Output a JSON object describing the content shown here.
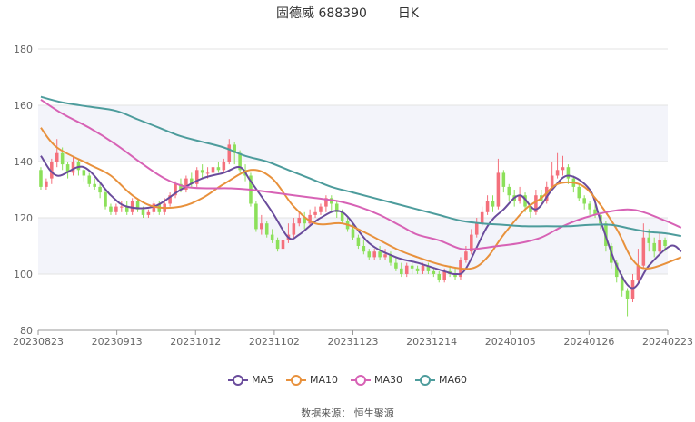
{
  "header": {
    "name_code": "固德威 688390",
    "period": "日K"
  },
  "source": "数据来源： 恒生聚源",
  "chart_data": {
    "type": "candlestick",
    "ylim": [
      80,
      180
    ],
    "yticks": [
      80,
      100,
      120,
      140,
      160,
      180
    ],
    "xticks": [
      "20230823",
      "20230913",
      "20231012",
      "20231102",
      "20231123",
      "20231214",
      "20240105",
      "20240126",
      "20240223"
    ],
    "colors": {
      "up": "#f4707c",
      "down": "#8ce05a",
      "MA5": "#6a4c9c",
      "MA10": "#e8913c",
      "MA30": "#d762b5",
      "MA60": "#4d9c9c"
    },
    "candles": [
      [
        137,
        131,
        138,
        130
      ],
      [
        131,
        133,
        134,
        130
      ],
      [
        134,
        140,
        141,
        132
      ],
      [
        140,
        143,
        148,
        138
      ],
      [
        143,
        139,
        145,
        137
      ],
      [
        139,
        136,
        140,
        134
      ],
      [
        136,
        140,
        142,
        135
      ],
      [
        140,
        137,
        141,
        135
      ],
      [
        137,
        135,
        138,
        133
      ],
      [
        135,
        132,
        136,
        131
      ],
      [
        132,
        131,
        134,
        130
      ],
      [
        131,
        129,
        133,
        127
      ],
      [
        129,
        124,
        130,
        123
      ],
      [
        124,
        122,
        125,
        121
      ],
      [
        122,
        124,
        125,
        121
      ],
      [
        124,
        124,
        126,
        122
      ],
      [
        124,
        122,
        126,
        121
      ],
      [
        122,
        126,
        127,
        121
      ],
      [
        126,
        123,
        127,
        122
      ],
      [
        123,
        121,
        124,
        120
      ],
      [
        121,
        122,
        123,
        120
      ],
      [
        122,
        125,
        126,
        121
      ],
      [
        125,
        122,
        126,
        121
      ],
      [
        122,
        125,
        127,
        121
      ],
      [
        125,
        128,
        129,
        124
      ],
      [
        128,
        132,
        133,
        127
      ],
      [
        132,
        130,
        134,
        129
      ],
      [
        130,
        134,
        135,
        129
      ],
      [
        134,
        132,
        136,
        131
      ],
      [
        132,
        137,
        138,
        131
      ],
      [
        137,
        136,
        139,
        134
      ],
      [
        136,
        136,
        138,
        134
      ],
      [
        136,
        138,
        140,
        135
      ],
      [
        138,
        137,
        140,
        136
      ],
      [
        137,
        140,
        141,
        136
      ],
      [
        140,
        146,
        148,
        139
      ],
      [
        146,
        143,
        147,
        139
      ],
      [
        143,
        137,
        144,
        136
      ],
      [
        137,
        135,
        139,
        133
      ],
      [
        135,
        125,
        136,
        124
      ],
      [
        125,
        116,
        126,
        115
      ],
      [
        116,
        118,
        121,
        114
      ],
      [
        118,
        114,
        119,
        113
      ],
      [
        114,
        112,
        116,
        111
      ],
      [
        112,
        109,
        113,
        108
      ],
      [
        109,
        112,
        115,
        108
      ],
      [
        112,
        114,
        118,
        111
      ],
      [
        114,
        118,
        120,
        113
      ],
      [
        118,
        120,
        122,
        117
      ],
      [
        120,
        118,
        122,
        116
      ],
      [
        118,
        121,
        123,
        117
      ],
      [
        121,
        122,
        124,
        120
      ],
      [
        122,
        124,
        125,
        121
      ],
      [
        124,
        127,
        128,
        122
      ],
      [
        127,
        125,
        128,
        122
      ],
      [
        125,
        122,
        126,
        120
      ],
      [
        122,
        119,
        123,
        118
      ],
      [
        119,
        116,
        120,
        115
      ],
      [
        116,
        113,
        118,
        112
      ],
      [
        113,
        110,
        114,
        109
      ],
      [
        110,
        108,
        112,
        107
      ],
      [
        108,
        106,
        109,
        105
      ],
      [
        106,
        108,
        109,
        105
      ],
      [
        108,
        106,
        110,
        105
      ],
      [
        106,
        107,
        109,
        105
      ],
      [
        107,
        104,
        108,
        103
      ],
      [
        104,
        102,
        106,
        101
      ],
      [
        102,
        100,
        104,
        99
      ],
      [
        100,
        103,
        104,
        99
      ],
      [
        103,
        102,
        104,
        100
      ],
      [
        102,
        101,
        103,
        100
      ],
      [
        101,
        103,
        104,
        100
      ],
      [
        103,
        101,
        104,
        100
      ],
      [
        101,
        100,
        102,
        99
      ],
      [
        100,
        98,
        101,
        97
      ],
      [
        98,
        101,
        102,
        97
      ],
      [
        101,
        100,
        103,
        99
      ],
      [
        100,
        99,
        102,
        98
      ],
      [
        99,
        105,
        106,
        98
      ],
      [
        105,
        108,
        110,
        104
      ],
      [
        108,
        114,
        116,
        107
      ],
      [
        114,
        118,
        120,
        113
      ],
      [
        118,
        122,
        124,
        117
      ],
      [
        122,
        126,
        128,
        121
      ],
      [
        126,
        124,
        128,
        122
      ],
      [
        124,
        136,
        141,
        123
      ],
      [
        136,
        131,
        137,
        129
      ],
      [
        131,
        128,
        132,
        126
      ],
      [
        128,
        126,
        130,
        124
      ],
      [
        126,
        128,
        131,
        125
      ],
      [
        128,
        124,
        129,
        122
      ],
      [
        124,
        122,
        125,
        120
      ],
      [
        122,
        128,
        130,
        121
      ],
      [
        128,
        126,
        130,
        124
      ],
      [
        126,
        131,
        133,
        125
      ],
      [
        131,
        135,
        140,
        130
      ],
      [
        135,
        137,
        143,
        134
      ],
      [
        137,
        138,
        142,
        135
      ],
      [
        138,
        134,
        139,
        132
      ],
      [
        134,
        131,
        135,
        129
      ],
      [
        131,
        127,
        132,
        126
      ],
      [
        127,
        125,
        128,
        123
      ],
      [
        125,
        123,
        126,
        121
      ],
      [
        123,
        121,
        125,
        120
      ],
      [
        121,
        118,
        122,
        116
      ],
      [
        118,
        110,
        119,
        108
      ],
      [
        110,
        104,
        111,
        102
      ],
      [
        104,
        99,
        105,
        97
      ],
      [
        99,
        94,
        100,
        92
      ],
      [
        94,
        91,
        95,
        85
      ],
      [
        91,
        98,
        100,
        90
      ],
      [
        98,
        103,
        109,
        97
      ],
      [
        103,
        113,
        118,
        102
      ],
      [
        113,
        111,
        116,
        108
      ],
      [
        111,
        108,
        113,
        106
      ],
      [
        108,
        112,
        115,
        107
      ],
      [
        112,
        110,
        113,
        108
      ]
    ],
    "series": [
      {
        "name": "MA5",
        "points": [
          [
            0,
            142
          ],
          [
            3,
            135
          ],
          [
            8,
            138
          ],
          [
            13,
            128
          ],
          [
            16,
            124
          ],
          [
            21,
            124
          ],
          [
            26,
            130
          ],
          [
            30,
            134
          ],
          [
            34,
            136
          ],
          [
            37,
            138
          ],
          [
            39,
            133
          ],
          [
            43,
            122
          ],
          [
            46,
            113
          ],
          [
            48,
            114
          ],
          [
            52,
            120
          ],
          [
            56,
            122
          ],
          [
            61,
            111
          ],
          [
            66,
            106
          ],
          [
            70,
            104
          ],
          [
            75,
            101
          ],
          [
            77,
            100
          ],
          [
            79,
            102
          ],
          [
            83,
            117
          ],
          [
            86,
            123
          ],
          [
            89,
            128
          ],
          [
            92,
            123
          ],
          [
            95,
            130
          ],
          [
            98,
            135
          ],
          [
            102,
            130
          ],
          [
            104,
            119
          ],
          [
            107,
            103
          ],
          [
            110,
            95
          ],
          [
            113,
            103
          ],
          [
            117,
            110
          ],
          [
            119,
            108
          ]
        ]
      },
      {
        "name": "MA10",
        "points": [
          [
            0,
            152
          ],
          [
            3,
            145
          ],
          [
            9,
            139
          ],
          [
            13,
            135
          ],
          [
            17,
            128
          ],
          [
            21,
            124
          ],
          [
            26,
            124
          ],
          [
            30,
            127
          ],
          [
            34,
            132
          ],
          [
            39,
            137
          ],
          [
            43,
            134
          ],
          [
            47,
            124
          ],
          [
            51,
            118
          ],
          [
            56,
            118
          ],
          [
            60,
            115
          ],
          [
            66,
            109
          ],
          [
            70,
            106
          ],
          [
            75,
            103
          ],
          [
            80,
            102
          ],
          [
            83,
            106
          ],
          [
            86,
            114
          ],
          [
            90,
            123
          ],
          [
            93,
            127
          ],
          [
            96,
            132
          ],
          [
            100,
            132
          ],
          [
            103,
            127
          ],
          [
            107,
            116
          ],
          [
            110,
            105
          ],
          [
            113,
            102
          ],
          [
            119,
            106
          ]
        ]
      },
      {
        "name": "MA30",
        "points": [
          [
            0,
            162
          ],
          [
            4,
            157
          ],
          [
            9,
            152
          ],
          [
            14,
            146
          ],
          [
            19,
            139
          ],
          [
            23,
            134
          ],
          [
            27,
            131
          ],
          [
            31,
            130.5
          ],
          [
            35,
            130.5
          ],
          [
            39,
            130
          ],
          [
            43,
            129
          ],
          [
            47,
            128
          ],
          [
            51,
            127
          ],
          [
            55,
            126
          ],
          [
            59,
            124
          ],
          [
            63,
            121
          ],
          [
            67,
            117
          ],
          [
            70,
            114
          ],
          [
            74,
            112
          ],
          [
            78,
            109
          ],
          [
            81,
            109
          ],
          [
            85,
            110
          ],
          [
            89,
            111
          ],
          [
            93,
            113
          ],
          [
            97,
            117
          ],
          [
            101,
            120
          ],
          [
            105,
            122
          ],
          [
            109,
            123
          ],
          [
            112,
            122
          ],
          [
            116,
            119
          ],
          [
            119,
            116.5
          ]
        ]
      },
      {
        "name": "MA60",
        "points": [
          [
            0,
            163
          ],
          [
            4,
            161
          ],
          [
            9,
            159.5
          ],
          [
            14,
            158
          ],
          [
            18,
            155
          ],
          [
            22,
            152
          ],
          [
            26,
            149
          ],
          [
            30,
            147
          ],
          [
            34,
            145
          ],
          [
            38,
            142
          ],
          [
            42,
            140
          ],
          [
            46,
            137
          ],
          [
            50,
            134
          ],
          [
            54,
            131
          ],
          [
            58,
            129
          ],
          [
            62,
            127
          ],
          [
            66,
            125
          ],
          [
            70,
            123
          ],
          [
            74,
            121
          ],
          [
            78,
            119
          ],
          [
            82,
            118
          ],
          [
            86,
            117.5
          ],
          [
            90,
            117
          ],
          [
            94,
            117
          ],
          [
            98,
            117
          ],
          [
            102,
            117.5
          ],
          [
            106,
            117.5
          ],
          [
            110,
            116
          ],
          [
            113,
            115
          ],
          [
            116,
            114.5
          ],
          [
            119,
            113.5
          ]
        ]
      }
    ]
  }
}
